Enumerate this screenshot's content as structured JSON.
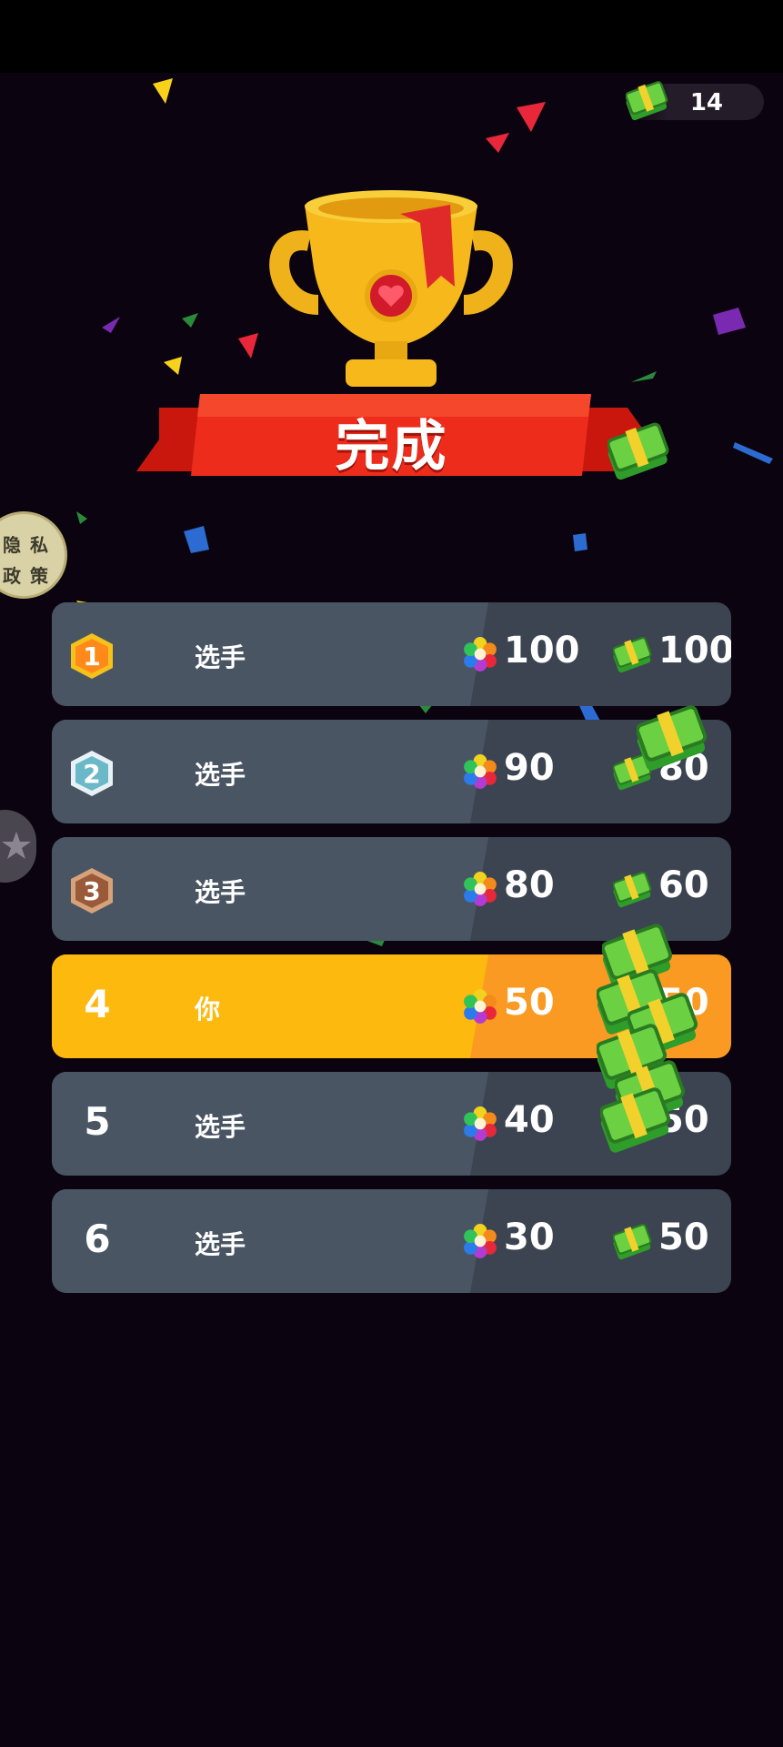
{
  "header": {
    "cash_count": "14"
  },
  "banner": {
    "title": "完成"
  },
  "privacy": {
    "line1_a": "隐",
    "line1_b": "私",
    "line2_a": "政",
    "line2_b": "策"
  },
  "leaderboard": [
    {
      "rank": "1",
      "name": "选手",
      "score": "100",
      "reward": "100",
      "badge": "gold"
    },
    {
      "rank": "2",
      "name": "选手",
      "score": "90",
      "reward": "80",
      "badge": "silver"
    },
    {
      "rank": "3",
      "name": "选手",
      "score": "80",
      "reward": "60",
      "badge": "bronze"
    },
    {
      "rank": "4",
      "name": "你",
      "score": "50",
      "reward": "50",
      "badge": "none"
    },
    {
      "rank": "5",
      "name": "选手",
      "score": "40",
      "reward": "50",
      "badge": "none"
    },
    {
      "rank": "6",
      "name": "选手",
      "score": "30",
      "reward": "50",
      "badge": "none"
    }
  ],
  "colors": {
    "background": "#0b0410",
    "row": "#4a5564",
    "you_row": "#fdb90e",
    "banner_red": "#e8281c",
    "trophy_gold": "#f6b81a"
  }
}
